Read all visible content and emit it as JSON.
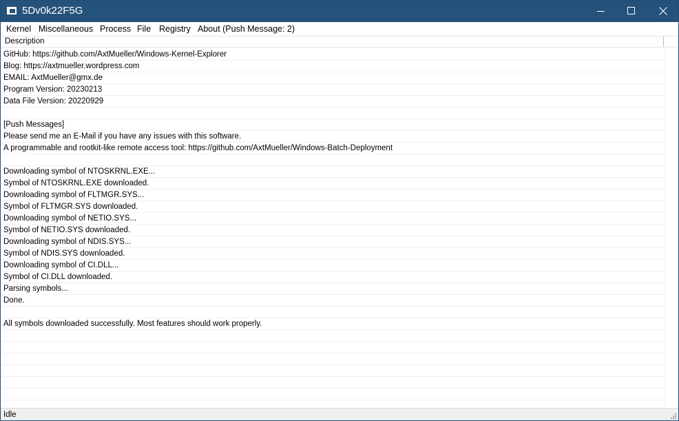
{
  "window": {
    "title": "5Dv0k22F5G",
    "title_bar_color": "#25527a"
  },
  "menu": [
    {
      "label": "Kernel"
    },
    {
      "label": "Miscellaneous"
    },
    {
      "label": "Process"
    },
    {
      "label": "File"
    },
    {
      "label": "Registry"
    },
    {
      "label": "About (Push Message: 2)"
    }
  ],
  "list": {
    "column_header": "Description",
    "rows": [
      "GitHub: https://github.com/AxtMueller/Windows-Kernel-Explorer",
      "Blog: https://axtmueller.wordpress.com",
      "EMAIL: AxtMueller@gmx.de",
      "Program Version: 20230213",
      "Data File Version: 20220929",
      "",
      "[Push Messages]",
      "Please send me an E-Mail if you have any issues with this software.",
      "A programmable and rootkit-like remote access tool: https://github.com/AxtMueller/Windows-Batch-Deployment",
      "",
      "Downloading symbol of NTOSKRNL.EXE...",
      "Symbol of NTOSKRNL.EXE downloaded.",
      "Downloading symbol of FLTMGR.SYS...",
      "Symbol of FLTMGR.SYS downloaded.",
      "Downloading symbol of NETIO.SYS...",
      "Symbol of NETIO.SYS downloaded.",
      "Downloading symbol of NDIS.SYS...",
      "Symbol of NDIS.SYS downloaded.",
      "Downloading symbol of CI.DLL...",
      "Symbol of CI.DLL downloaded.",
      "Parsing symbols...",
      "Done.",
      "",
      "All symbols downloaded successfully. Most features should work properly.",
      "",
      "",
      "",
      "",
      "",
      ""
    ]
  },
  "status": {
    "text": "Idle"
  },
  "icons": {
    "app": "window-icon",
    "minimize": "minimize-icon",
    "maximize": "maximize-icon",
    "close": "close-icon",
    "grip": "resize-grip-icon"
  }
}
